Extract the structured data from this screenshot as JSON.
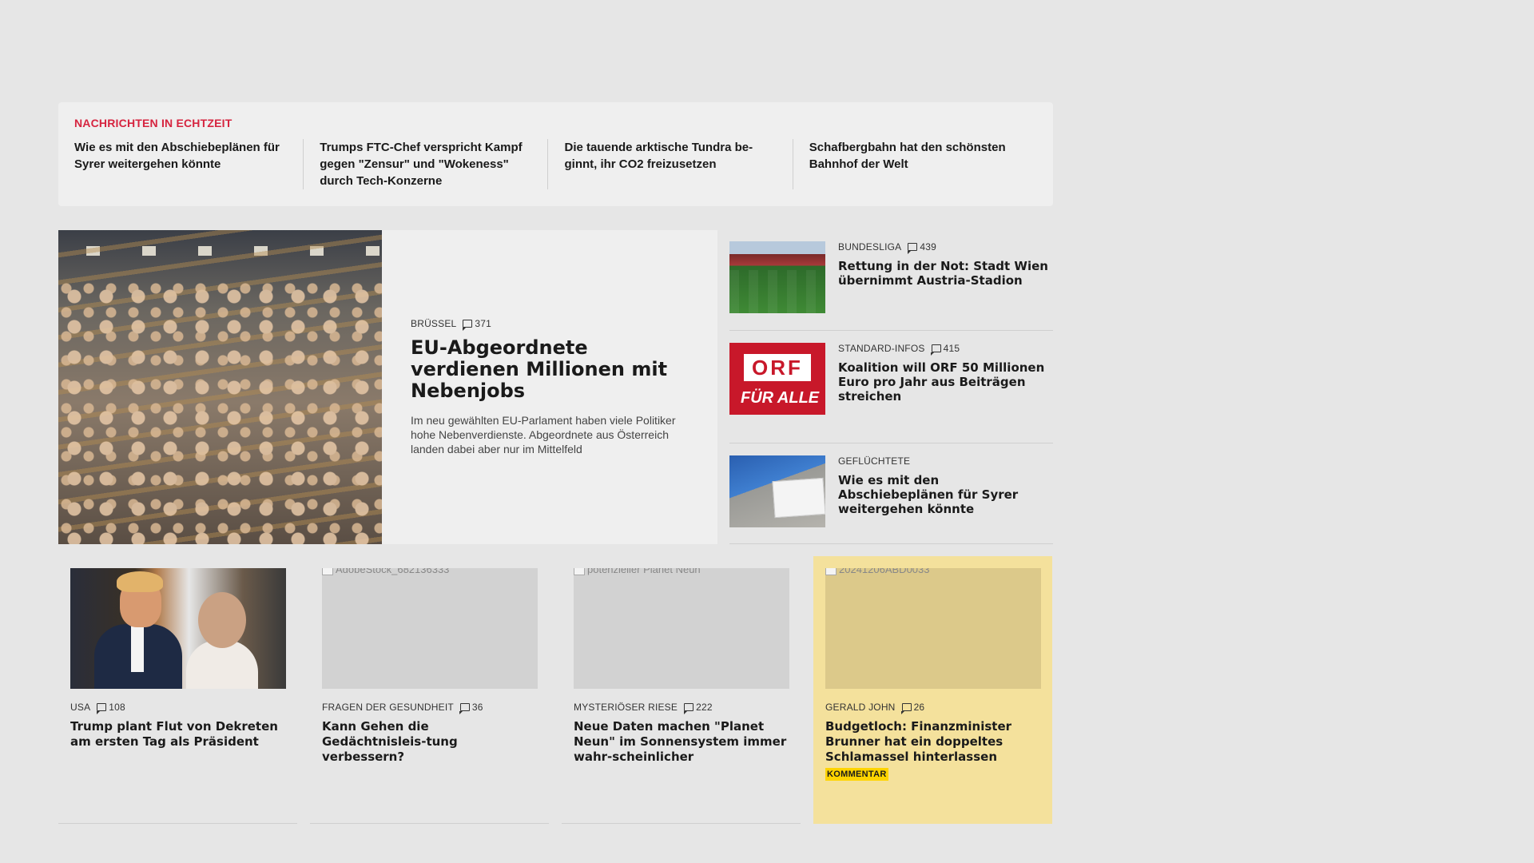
{
  "ticker": {
    "label": "NACHRICHTEN IN ECHTZEIT",
    "items": [
      "Wie es mit den Abschiebeplänen für Syrer weitergehen könnte",
      "Trumps FTC-Chef verspricht Kampf gegen \"Zensur\" und \"Wokeness\" durch Tech-Konzerne",
      "Die tauende arktische Tundra be-ginnt, ihr CO2 freizusetzen",
      "Schafbergbahn hat den schönsten Bahnhof der Welt"
    ]
  },
  "lead": {
    "kicker": "BRÜSSEL",
    "comments": "371",
    "title": "EU-Abgeordnete verdienen Millionen mit Nebenjobs",
    "teaser": "Im neu gewählten EU-Parlament haben viele Politiker hohe Nebenverdienste. Abgeordnete aus Österreich landen dabei aber nur im Mittelfeld"
  },
  "side": [
    {
      "kicker": "BUNDESLIGA",
      "comments": "439",
      "title": "Rettung in der Not: Stadt Wien übernimmt Austria-Stadion"
    },
    {
      "kicker": "STANDARD-INFOS",
      "comments": "415",
      "title": "Koalition will ORF 50 Millionen Euro pro Jahr aus Beiträgen streichen",
      "image_text": [
        "ORF",
        "FÜR ALLE"
      ]
    },
    {
      "kicker": "GEFLÜCHTETE",
      "comments": "",
      "title": "Wie es mit den Abschiebeplänen für Syrer weitergehen könnte"
    }
  ],
  "cards": [
    {
      "kicker": "USA",
      "comments": "108",
      "title": "Trump plant Flut von Dekreten am ersten Tag als Präsident",
      "alt": ""
    },
    {
      "kicker": "FRAGEN DER GESUNDHEIT",
      "comments": "36",
      "title": "Kann Gehen die Gedächtnisleis-tung verbessern?",
      "alt": "AdobeStock_682136333"
    },
    {
      "kicker": "MYSTERIÖSER RIESE",
      "comments": "222",
      "title": "Neue Daten machen \"Planet Neun\" im Sonnensystem immer wahr-scheinlicher",
      "alt": "potenzieller Planet Neun"
    },
    {
      "kicker": "GERALD JOHN",
      "comments": "26",
      "title": "Budgetloch: Finanzminister Brunner hat ein doppeltes Schlamassel hinterlassen",
      "alt": "20241206ABD0033",
      "badge": "KOMMENTAR"
    }
  ],
  "colors": {
    "accent": "#d6243f",
    "opinion_bg": "#f4e19c",
    "badge": "#ffd400",
    "page_bg": "#e6e6e6"
  }
}
